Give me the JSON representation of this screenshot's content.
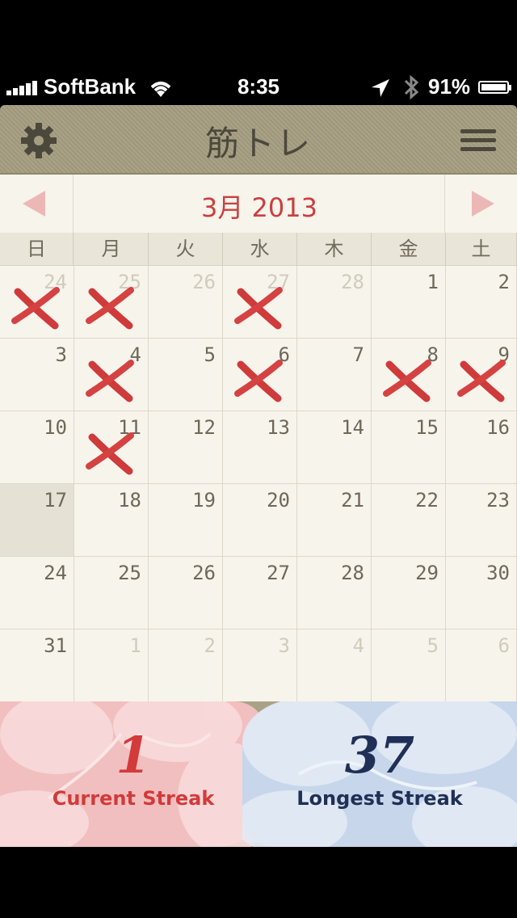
{
  "status": {
    "carrier": "SoftBank",
    "time": "8:35",
    "battery": "91%",
    "battery_level": 0.91
  },
  "nav": {
    "title": "筋トレ",
    "left_icon": "gear-icon",
    "right_icon": "list-icon"
  },
  "calendar": {
    "month_label": "3月 2013",
    "weekdays": [
      "日",
      "月",
      "火",
      "水",
      "木",
      "金",
      "土"
    ],
    "days": [
      {
        "n": "24",
        "other": true,
        "x": true
      },
      {
        "n": "25",
        "other": true,
        "x": true
      },
      {
        "n": "26",
        "other": true
      },
      {
        "n": "27",
        "other": true,
        "x": true
      },
      {
        "n": "28",
        "other": true
      },
      {
        "n": "1"
      },
      {
        "n": "2"
      },
      {
        "n": "3"
      },
      {
        "n": "4",
        "x": true
      },
      {
        "n": "5"
      },
      {
        "n": "6",
        "x": true
      },
      {
        "n": "7"
      },
      {
        "n": "8",
        "x": true
      },
      {
        "n": "9",
        "x": true
      },
      {
        "n": "10"
      },
      {
        "n": "11",
        "x": true
      },
      {
        "n": "12"
      },
      {
        "n": "13"
      },
      {
        "n": "14"
      },
      {
        "n": "15"
      },
      {
        "n": "16"
      },
      {
        "n": "17",
        "today": true
      },
      {
        "n": "18"
      },
      {
        "n": "19"
      },
      {
        "n": "20"
      },
      {
        "n": "21"
      },
      {
        "n": "22"
      },
      {
        "n": "23"
      },
      {
        "n": "24"
      },
      {
        "n": "25"
      },
      {
        "n": "26"
      },
      {
        "n": "27"
      },
      {
        "n": "28"
      },
      {
        "n": "29"
      },
      {
        "n": "30"
      },
      {
        "n": "31"
      },
      {
        "n": "1",
        "other": true
      },
      {
        "n": "2",
        "other": true
      },
      {
        "n": "3",
        "other": true
      },
      {
        "n": "4",
        "other": true
      },
      {
        "n": "5",
        "other": true
      },
      {
        "n": "6",
        "other": true
      }
    ]
  },
  "streaks": {
    "current": {
      "value": "1",
      "label": "Current Streak",
      "color": "#d33a3a"
    },
    "longest": {
      "value": "37",
      "label": "Longest Streak",
      "color": "#1f2f55"
    }
  }
}
